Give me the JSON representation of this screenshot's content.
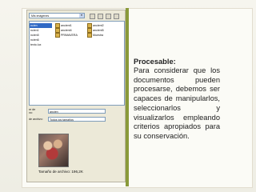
{
  "dialog": {
    "look_in": "Mis imágenes",
    "left_names": [
      "ncien",
      "ncien1",
      "ncien5",
      "ncien6",
      "texto.lux"
    ],
    "files": [
      {
        "name": "ancient1"
      },
      {
        "name": "ancient2"
      },
      {
        "name": "ancient4"
      },
      {
        "name": "ancient5"
      },
      {
        "name": "PRIMAVERA"
      },
      {
        "name": "Muestra"
      }
    ],
    "form": {
      "file_name_label": "re de\nvo:",
      "file_name_value": "ancien",
      "file_type_label": "de archivo:",
      "file_type_value": "Todos los tamaños"
    },
    "file_size": "Tamaño de archivo: 196,2K"
  },
  "content": {
    "title": "Procesable:",
    "body": "Para considerar que los documentos pueden procesarse, debemos ser capaces de manipularlos, seleccionarlos y visualizarlos empleando criterios apropiados para su conservación."
  },
  "colors": {
    "accent": "#8a9a3a",
    "selection": "#316ac5"
  }
}
